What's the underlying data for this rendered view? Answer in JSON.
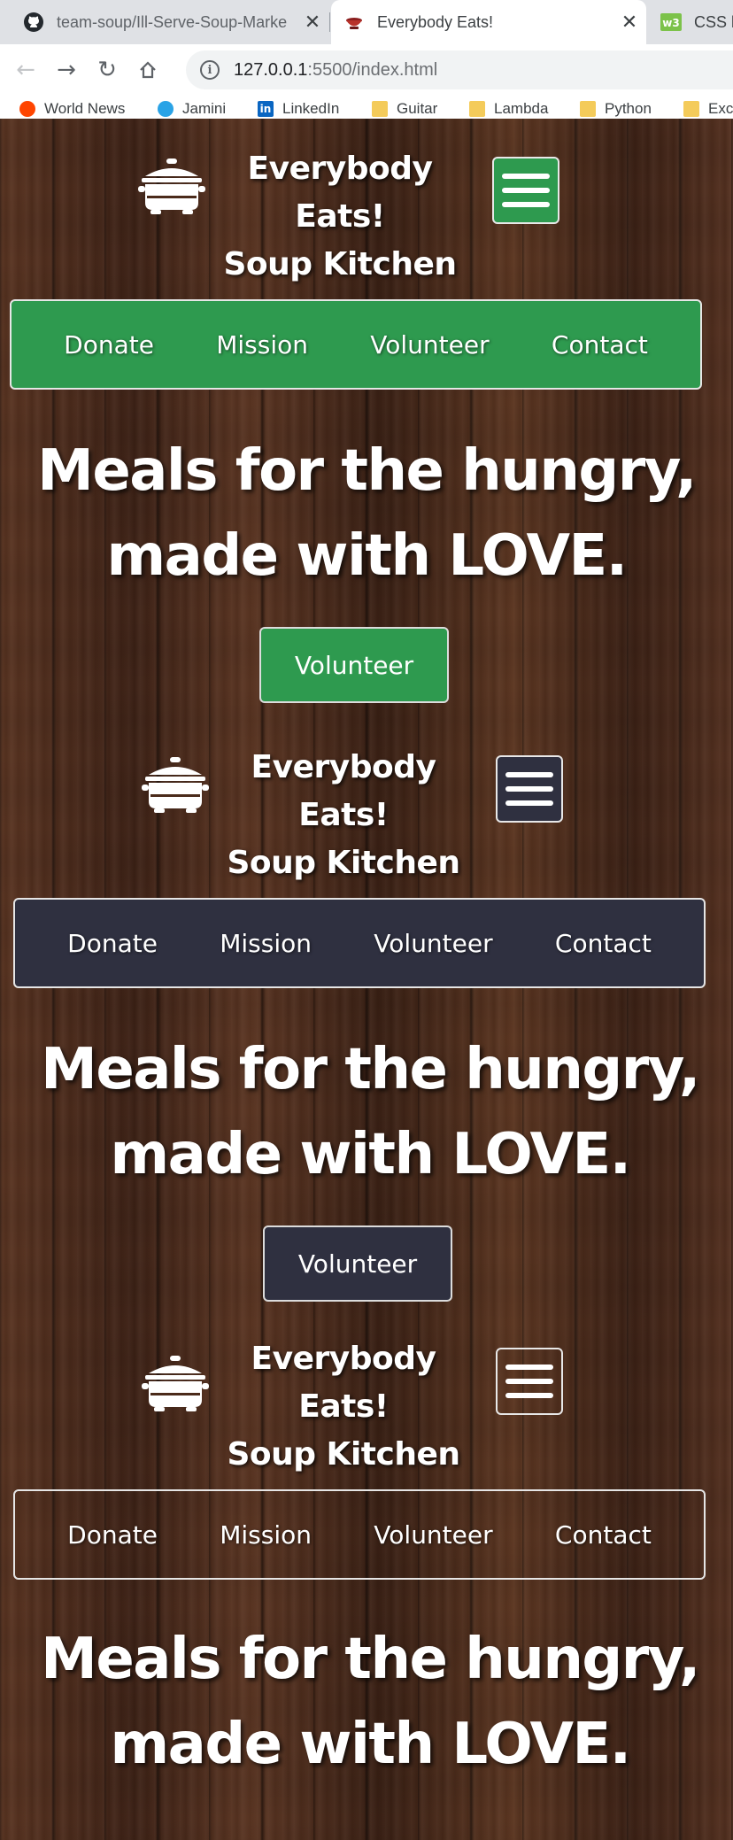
{
  "browser": {
    "tabs": [
      {
        "title": "team-soup/Ill-Serve-Soup-Marke",
        "icon": "github-icon"
      },
      {
        "title": "Everybody Eats!",
        "icon": "soup-bowl-icon",
        "active": true
      },
      {
        "title": "CSS b",
        "icon": "w3schools-icon"
      }
    ],
    "close_glyph": "✕",
    "url_host": "127.0.0.1",
    "url_rest": ":5500/index.html",
    "bookmarks": [
      {
        "label": "World News",
        "icon": "reddit-icon"
      },
      {
        "label": "Jamini",
        "icon": "jamini-icon"
      },
      {
        "label": "LinkedIn",
        "icon": "linkedin-icon"
      },
      {
        "label": "Guitar",
        "icon": "folder-icon"
      },
      {
        "label": "Lambda",
        "icon": "folder-icon"
      },
      {
        "label": "Python",
        "icon": "folder-icon"
      },
      {
        "label": "Exc",
        "icon": "folder-icon"
      }
    ]
  },
  "site": {
    "brand_line1": "Everybody Eats!",
    "brand_line2": "Soup Kitchen",
    "nav": [
      "Donate",
      "Mission",
      "Volunteer",
      "Contact"
    ],
    "hero_line1": "Meals for the hungry,",
    "hero_line2": "made with LOVE.",
    "cta": "Volunteer"
  },
  "colors": {
    "green": "#2e9a4f",
    "slate": "#2f3040",
    "wood": "#4a2a1a"
  }
}
